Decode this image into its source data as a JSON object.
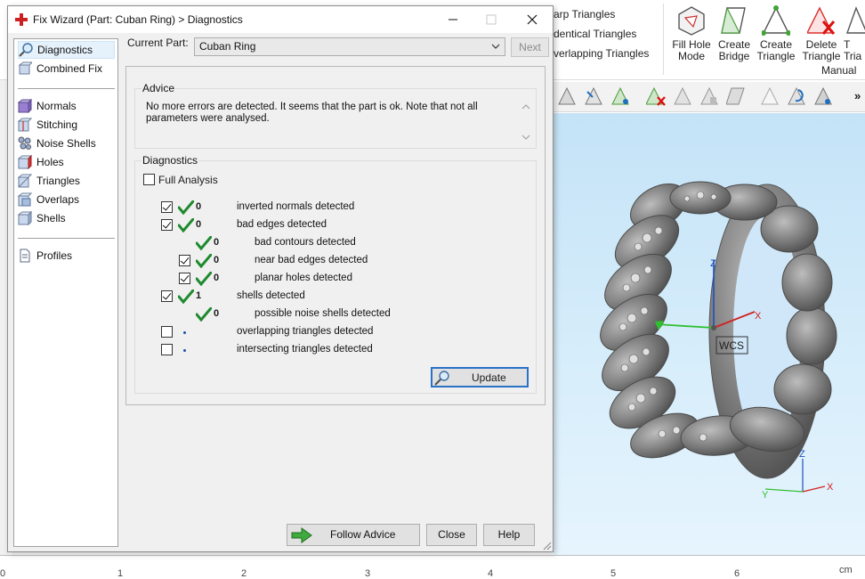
{
  "dialog": {
    "title": "Fix Wizard (Part: Cuban Ring) > Diagnostics",
    "current_part_label": "Current Part:",
    "current_part_value": "Cuban Ring",
    "next_label": "Next",
    "nav": {
      "top": [
        "Diagnostics",
        "Combined Fix"
      ],
      "middle": [
        "Normals",
        "Stitching",
        "Noise Shells",
        "Holes",
        "Triangles",
        "Overlaps",
        "Shells"
      ],
      "bottom": [
        "Profiles"
      ]
    },
    "advice": {
      "title": "Advice",
      "text": "No more errors are detected. It seems that the part is ok. Note that not all parameters were analysed."
    },
    "diagnostics": {
      "title": "Diagnostics",
      "full_analysis_label": "Full Analysis",
      "rows": [
        {
          "count": "0",
          "label": "inverted normals detected",
          "checked": true,
          "ok": true
        },
        {
          "count": "0",
          "label": "bad edges detected",
          "checked": true,
          "ok": true
        },
        {
          "count": "0",
          "label": "bad contours detected",
          "checked": null,
          "ok": true
        },
        {
          "count": "0",
          "label": "near bad edges detected",
          "checked": true,
          "ok": true
        },
        {
          "count": "0",
          "label": "planar holes detected",
          "checked": true,
          "ok": true
        },
        {
          "count": "1",
          "label": "shells detected",
          "checked": true,
          "ok": true
        },
        {
          "count": "0",
          "label": "possible noise shells detected",
          "checked": null,
          "ok": true
        },
        {
          "count": "",
          "label": "overlapping triangles detected",
          "checked": false,
          "ok": false
        },
        {
          "count": "",
          "label": "intersecting triangles detected",
          "checked": false,
          "ok": false
        }
      ]
    },
    "update_label": "Update",
    "follow_advice_label": "Follow Advice",
    "close_label": "Close",
    "help_label": "Help"
  },
  "ribbon": {
    "list_items": [
      "arp Triangles",
      "dentical Triangles",
      "verlapping Triangles"
    ],
    "buttons": [
      {
        "label": "Fill Hole\nMode",
        "icon": "fill-hole-icon"
      },
      {
        "label": "Create\nBridge",
        "icon": "create-bridge-icon"
      },
      {
        "label": "Create\nTriangle",
        "icon": "create-triangle-icon"
      },
      {
        "label": "Delete\nTriangle",
        "icon": "delete-triangle-icon"
      },
      {
        "label": "T\nTria",
        "icon": "triangle-tool-icon"
      }
    ],
    "group_label": "Manual"
  },
  "viewport": {
    "axis_labels": {
      "x": "X",
      "z": "Z",
      "wcs": "WCS"
    },
    "corner_axis_labels": {
      "x": "X",
      "z": "Z",
      "y": "Y"
    }
  },
  "ruler": {
    "ticks": [
      "0",
      "1",
      "2",
      "3",
      "4",
      "5",
      "6",
      "cm"
    ]
  },
  "colors": {
    "accent": "#2a72c7",
    "check_green": "#1e8a2e",
    "viewport_top": "#c4e3f7",
    "title_icon_red": "#cc1f1f"
  }
}
